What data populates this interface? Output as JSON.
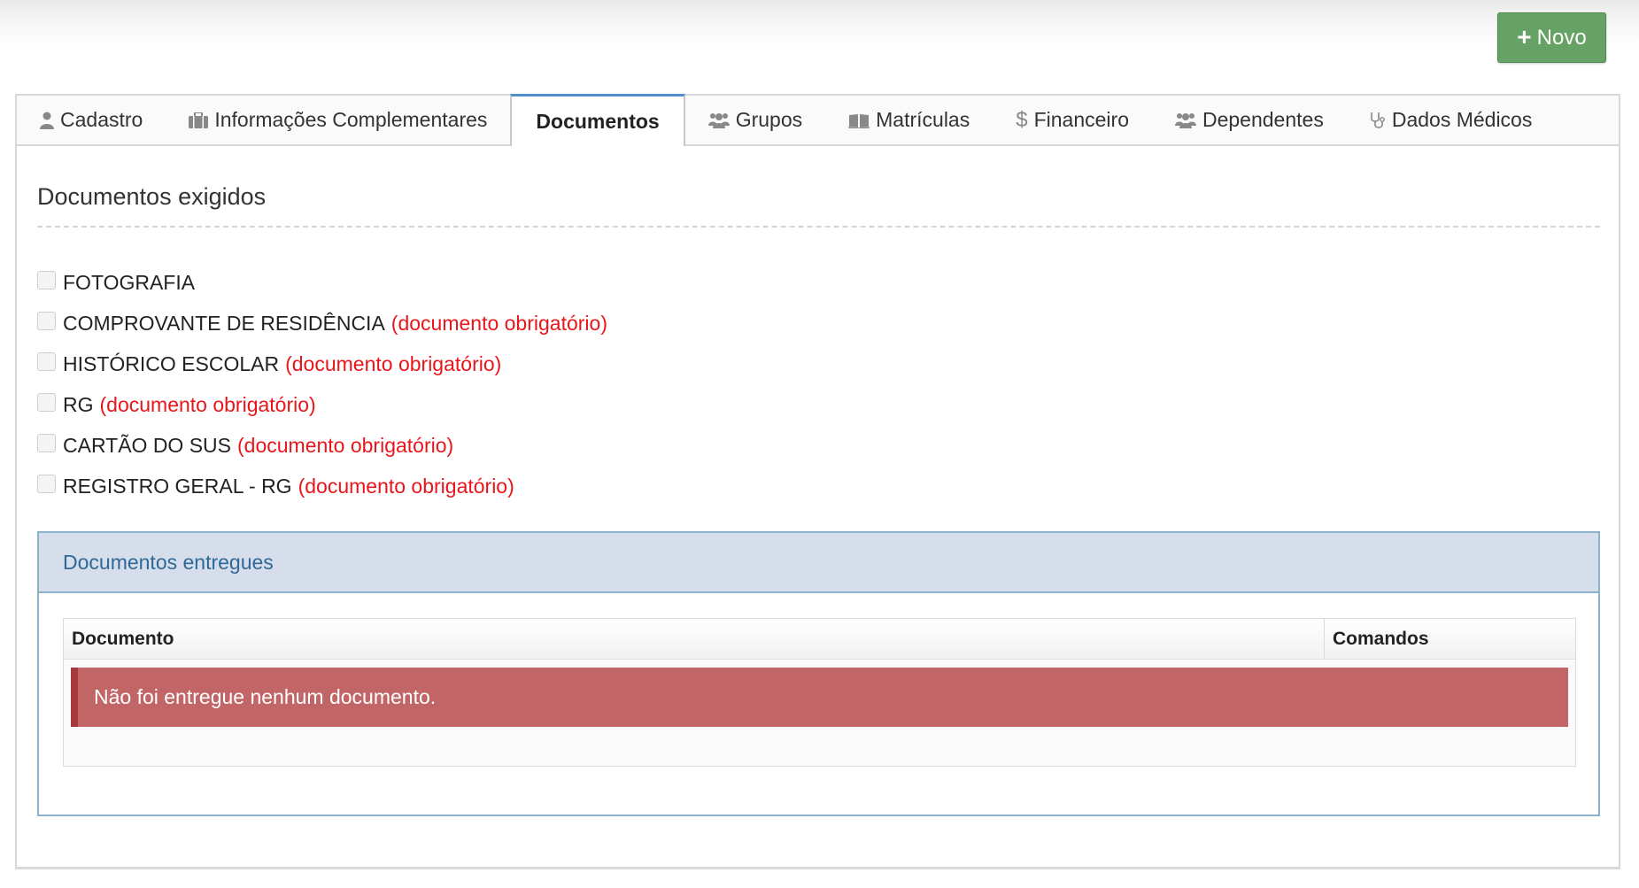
{
  "toolbar": {
    "new_button": "Novo"
  },
  "tabs": [
    {
      "label": "Cadastro",
      "icon": "user-icon"
    },
    {
      "label": "Informações Complementares",
      "icon": "briefcase-icon"
    },
    {
      "label": "Documentos",
      "icon": "",
      "active": true
    },
    {
      "label": "Grupos",
      "icon": "users-icon"
    },
    {
      "label": "Matrículas",
      "icon": "book-icon"
    },
    {
      "label": "Financeiro",
      "icon": "dollar-icon"
    },
    {
      "label": "Dependentes",
      "icon": "users-icon"
    },
    {
      "label": "Dados Médicos",
      "icon": "stethoscope-icon"
    }
  ],
  "required_docs": {
    "title": "Documentos exigidos",
    "items": [
      {
        "label": "FOTOGRAFIA",
        "note": "",
        "checked": false
      },
      {
        "label": "COMPROVANTE DE RESIDÊNCIA",
        "note": "(documento obrigatório)",
        "checked": false
      },
      {
        "label": "HISTÓRICO ESCOLAR",
        "note": "(documento obrigatório)",
        "checked": false
      },
      {
        "label": "RG",
        "note": "(documento obrigatório)",
        "checked": false
      },
      {
        "label": "CARTÃO DO SUS",
        "note": "(documento obrigatório)",
        "checked": false
      },
      {
        "label": "REGISTRO GERAL - RG",
        "note": "(documento obrigatório)",
        "checked": false
      }
    ]
  },
  "delivered_docs": {
    "title": "Documentos entregues",
    "columns": [
      "Documento",
      "Comandos"
    ],
    "empty_message": "Não foi entregue nenhum documento."
  },
  "colors": {
    "primary_button": "#66a265",
    "active_tab_accent": "#4f8ec9",
    "required_note": "#e8161b",
    "panel_header_bg": "#d5deea",
    "panel_header_text": "#2f6898",
    "alert_bg": "#c26566"
  }
}
